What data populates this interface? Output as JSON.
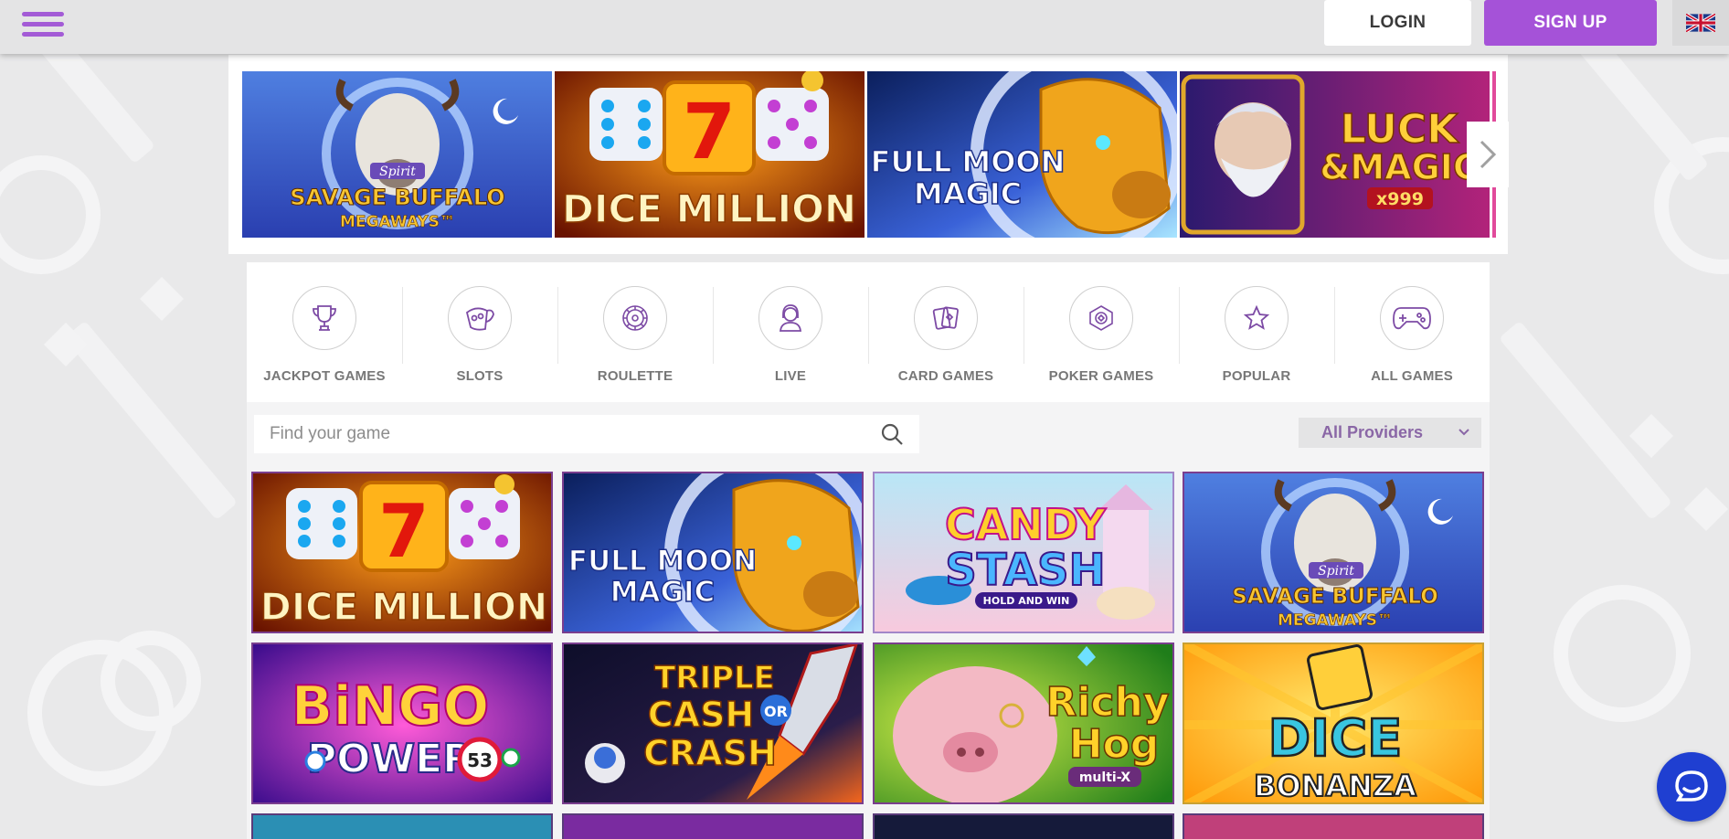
{
  "header": {
    "menu_icon": "hamburger-icon",
    "login_label": "LOGIN",
    "signup_label": "SIGN UP",
    "language_icon": "uk-flag-icon"
  },
  "carousel": {
    "slides": [
      {
        "line1": "Spirit",
        "line2": "SAVAGE BUFFALO",
        "line3": "MEGAWAYS™"
      },
      {
        "line1": "DICE MILLION"
      },
      {
        "line1": "FULL MOON",
        "line2": "MAGIC"
      },
      {
        "line1": "LUCK",
        "line2": "&MAGIC",
        "line3": "x999"
      }
    ],
    "next_icon": "chevron-right-icon"
  },
  "categories": [
    {
      "label": "JACKPOT GAMES",
      "icon": "trophy-icon"
    },
    {
      "label": "SLOTS",
      "icon": "slot-machine-icon"
    },
    {
      "label": "ROULETTE",
      "icon": "roulette-icon"
    },
    {
      "label": "LIVE",
      "icon": "live-dealer-icon"
    },
    {
      "label": "CARD GAMES",
      "icon": "cards-icon"
    },
    {
      "label": "POKER GAMES",
      "icon": "poker-chip-icon"
    },
    {
      "label": "POPULAR",
      "icon": "star-icon"
    },
    {
      "label": "ALL GAMES",
      "icon": "gamepad-icon"
    }
  ],
  "search": {
    "placeholder": "Find your game",
    "icon": "search-icon"
  },
  "providers": {
    "selected": "All Providers",
    "icon": "chevron-down-icon"
  },
  "games": [
    {
      "line1": "DICE MILLION"
    },
    {
      "line1": "FULL MOON",
      "line2": "MAGIC"
    },
    {
      "line1": "CANDY",
      "line2": "STASH",
      "line3": "HOLD AND WIN"
    },
    {
      "line1": "Spirit",
      "line2": "SAVAGE BUFFALO",
      "line3": "MEGAWAYS™"
    },
    {
      "line1": "BiNGO",
      "line2": "POWER",
      "line3": "53"
    },
    {
      "line1": "TRIPLE",
      "line2": "CASH",
      "line3": "OR",
      "line4": "CRASH"
    },
    {
      "line1": "Richy",
      "line2": "Hog",
      "line3": "multi-X"
    },
    {
      "line1": "DICE",
      "line2": "BONANZA"
    }
  ],
  "chat": {
    "icon": "chat-bubble-icon"
  },
  "colors": {
    "brand_purple": "#a552d8",
    "chat_blue": "#1f3fd1",
    "header_bg": "#e4e4e5"
  }
}
